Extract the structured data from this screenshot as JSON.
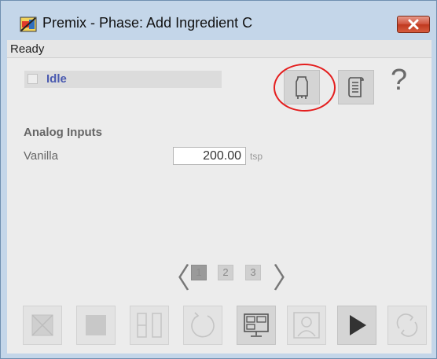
{
  "window": {
    "title": "Premix - Phase: Add Ingredient C",
    "close_icon": "close-icon"
  },
  "status_bar": {
    "text": "Ready"
  },
  "state": {
    "label": "Idle",
    "checked": false
  },
  "toolbar": {
    "help_label": "?",
    "icons": [
      "equipment-icon",
      "log-icon",
      "help-icon"
    ]
  },
  "section": {
    "title": "Analog Inputs"
  },
  "inputs": [
    {
      "label": "Vanilla",
      "value": "200.00",
      "unit": "tsp"
    }
  ],
  "pager": {
    "prev": "〈",
    "next": "〉",
    "pages": [
      "1",
      "2",
      "3"
    ],
    "current": "1"
  },
  "commands": [
    {
      "icon": "abort-icon",
      "enabled": false
    },
    {
      "icon": "stop-icon",
      "enabled": false
    },
    {
      "icon": "hold-icon",
      "enabled": false
    },
    {
      "icon": "restart-icon",
      "enabled": false
    },
    {
      "icon": "faceplate-icon",
      "enabled": true
    },
    {
      "icon": "operator-icon",
      "enabled": false
    },
    {
      "icon": "start-icon",
      "enabled": true
    },
    {
      "icon": "reset-icon",
      "enabled": false
    }
  ],
  "colors": {
    "highlight": "#e41e1e",
    "state_label": "#4a5ab0",
    "close_button": "#c0391f"
  }
}
